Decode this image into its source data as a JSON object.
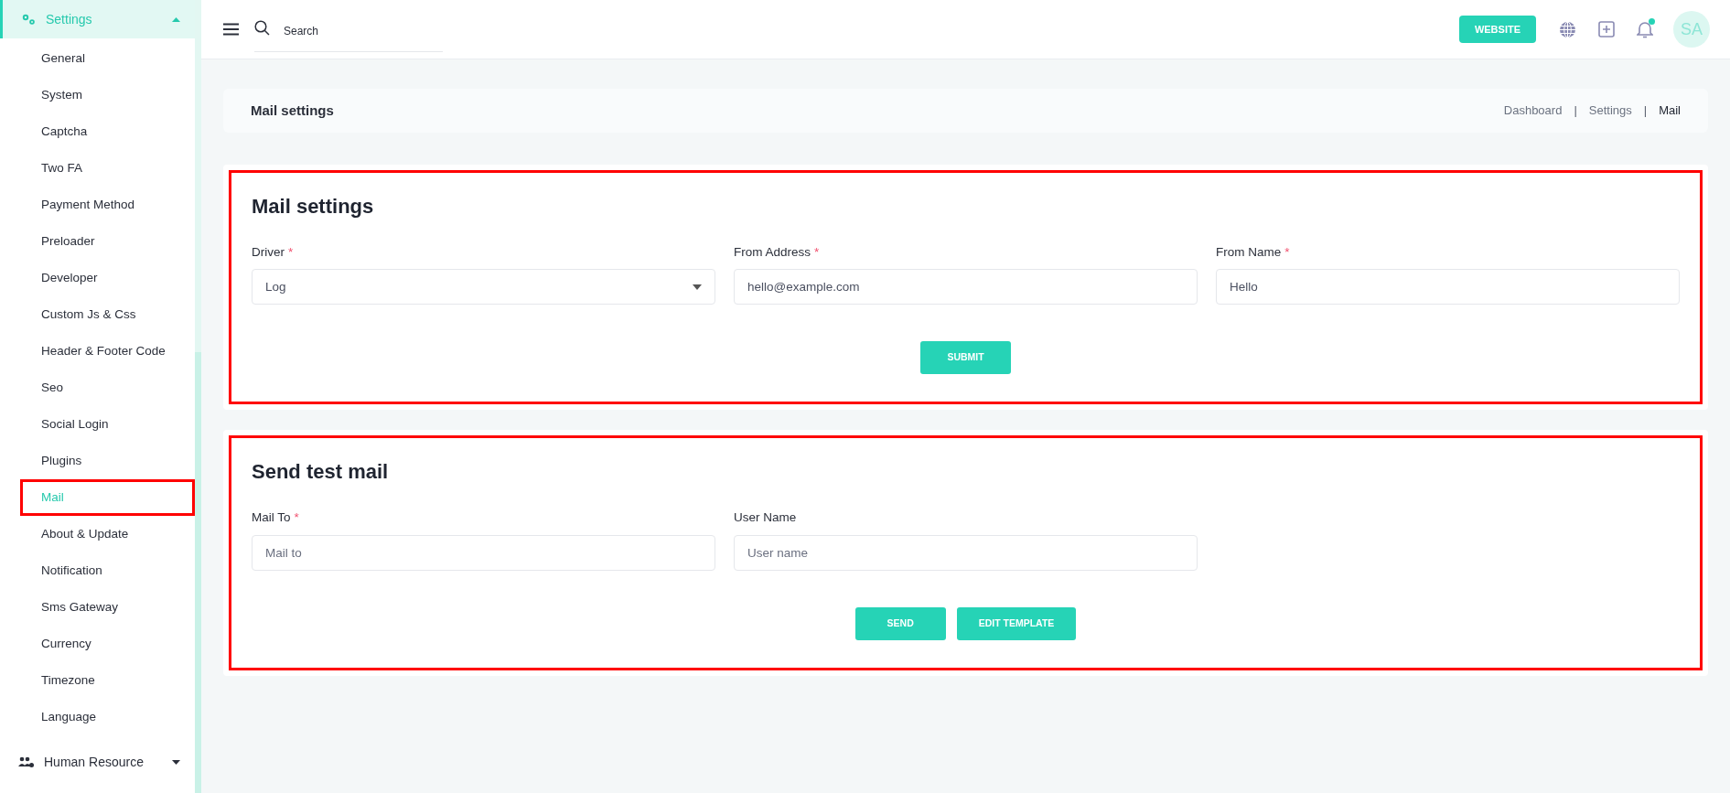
{
  "sidebar": {
    "group": {
      "label": "Settings",
      "expanded": true
    },
    "items": [
      {
        "label": "General",
        "selected": false,
        "highlighted": false
      },
      {
        "label": "System",
        "selected": false,
        "highlighted": false
      },
      {
        "label": "Captcha",
        "selected": false,
        "highlighted": false
      },
      {
        "label": "Two FA",
        "selected": false,
        "highlighted": false
      },
      {
        "label": "Payment Method",
        "selected": false,
        "highlighted": false
      },
      {
        "label": "Preloader",
        "selected": false,
        "highlighted": false
      },
      {
        "label": "Developer",
        "selected": false,
        "highlighted": false
      },
      {
        "label": "Custom Js & Css",
        "selected": false,
        "highlighted": false
      },
      {
        "label": "Header & Footer Code",
        "selected": false,
        "highlighted": false
      },
      {
        "label": "Seo",
        "selected": false,
        "highlighted": false
      },
      {
        "label": "Social Login",
        "selected": false,
        "highlighted": false
      },
      {
        "label": "Plugins",
        "selected": false,
        "highlighted": false
      },
      {
        "label": "Mail",
        "selected": true,
        "highlighted": true
      },
      {
        "label": "About & Update",
        "selected": false,
        "highlighted": false
      },
      {
        "label": "Notification",
        "selected": false,
        "highlighted": false
      },
      {
        "label": "Sms Gateway",
        "selected": false,
        "highlighted": false
      },
      {
        "label": "Currency",
        "selected": false,
        "highlighted": false
      },
      {
        "label": "Timezone",
        "selected": false,
        "highlighted": false
      },
      {
        "label": "Language",
        "selected": false,
        "highlighted": false
      }
    ],
    "next_group": {
      "label": "Human Resource",
      "expanded": false
    }
  },
  "topbar": {
    "search": {
      "placeholder": "Search"
    },
    "website_button": "WEBSITE",
    "avatar": "SA",
    "notification_dot": true
  },
  "page_header": {
    "title": "Mail settings",
    "breadcrumb": [
      {
        "label": "Dashboard",
        "current": false
      },
      {
        "separator": "|",
        "label": "Settings",
        "current": false
      },
      {
        "separator": "|",
        "label": "Mail",
        "current": true
      }
    ]
  },
  "sections": [
    {
      "title": "Mail settings",
      "highlighted": true,
      "fields": [
        {
          "kind": "select",
          "label": "Driver",
          "required_mark": "*",
          "value": "Log"
        },
        {
          "kind": "text",
          "label": "From Address",
          "required_mark": "*",
          "value": "hello@example.com"
        },
        {
          "kind": "text",
          "label": "From Name",
          "required_mark": "*",
          "value": "Hello"
        }
      ],
      "buttons": [
        "SUBMIT"
      ]
    },
    {
      "title": "Send test mail",
      "highlighted": true,
      "fields": [
        {
          "kind": "text",
          "label": "Mail To",
          "required_mark": "*",
          "placeholder": "Mail to"
        },
        {
          "kind": "text",
          "label": "User Name",
          "placeholder": "User name"
        }
      ],
      "buttons": [
        "SEND",
        "EDIT TEMPLATE"
      ]
    }
  ]
}
